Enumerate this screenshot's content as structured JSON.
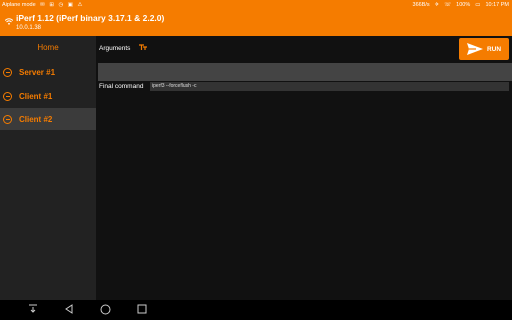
{
  "status": {
    "left": [
      "Aiplane mode",
      "✉",
      "⊞",
      "◷",
      "▣",
      "⚠"
    ],
    "right": [
      "366B/s",
      "✈",
      "☏",
      "100%",
      "▭",
      "10:17 PM"
    ]
  },
  "app": {
    "title": "iPerf 1.12 (iPerf binary 3.17.1 & 2.2.0)",
    "subtitle": "10.0.1.38"
  },
  "sidebar": {
    "home": "Home",
    "items": [
      "Server #1",
      "Client #1",
      "Client #2"
    ]
  },
  "main": {
    "arguments_label": "Arguments",
    "run_label": "RUN",
    "arguments_value": "",
    "final_label": "Final command",
    "final_value": "iperf3 --forceflush -c"
  },
  "colors": {
    "accent": "#f57c00"
  }
}
